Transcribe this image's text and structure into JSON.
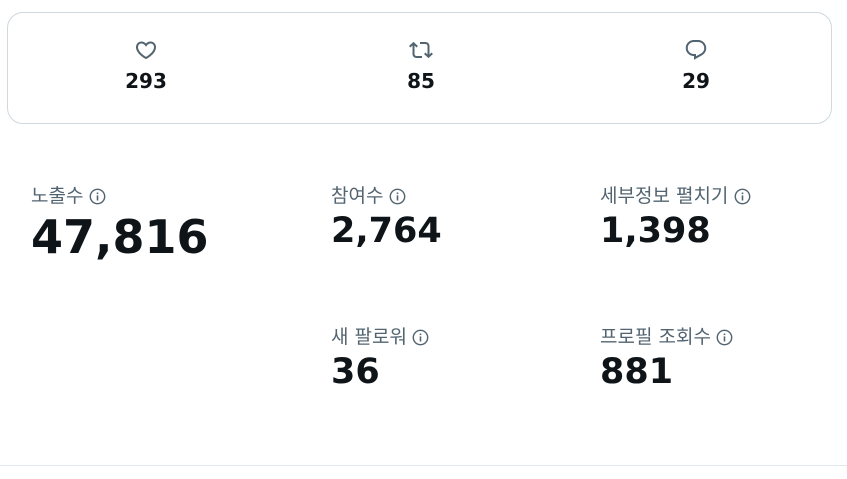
{
  "engagement": {
    "likes": {
      "icon": "heart-icon",
      "count": "293"
    },
    "reposts": {
      "icon": "repost-icon",
      "count": "85"
    },
    "replies": {
      "icon": "reply-icon",
      "count": "29"
    }
  },
  "metrics": {
    "impressions": {
      "label": "노출수",
      "value": "47,816"
    },
    "engagements": {
      "label": "참여수",
      "value": "2,764"
    },
    "detail_expands": {
      "label": "세부정보 펼치기",
      "value": "1,398"
    },
    "new_followers": {
      "label": "새 팔로워",
      "value": "36"
    },
    "profile_visits": {
      "label": "프로필 조회수",
      "value": "881"
    }
  },
  "colors": {
    "text_primary": "#0f1419",
    "text_secondary": "#536471",
    "border": "#cfd9de"
  }
}
